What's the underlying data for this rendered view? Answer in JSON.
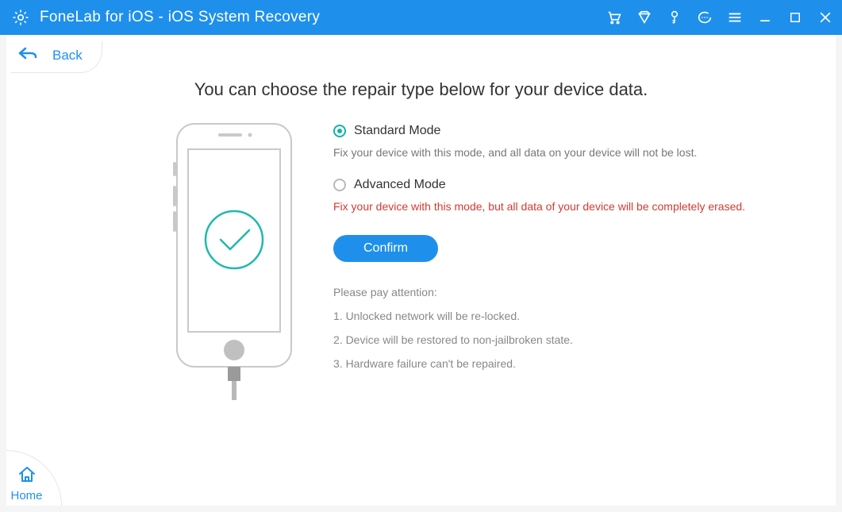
{
  "titlebar": {
    "title": "FoneLab for iOS - iOS System Recovery"
  },
  "back": {
    "label": "Back"
  },
  "main": {
    "heading": "You can choose the repair type below for your device data.",
    "option_standard": {
      "label": "Standard Mode",
      "desc": "Fix your device with this mode, and all data on your device will not be lost.",
      "selected": true
    },
    "option_advanced": {
      "label": "Advanced Mode",
      "desc": "Fix your device with this mode, but all data of your device will be completely erased.",
      "selected": false
    },
    "confirm_label": "Confirm",
    "attention_title": "Please pay attention:",
    "attention": [
      "1. Unlocked network will be re-locked.",
      "2. Device will be restored to non-jailbroken state.",
      "3. Hardware failure can't be repaired."
    ]
  },
  "home": {
    "label": "Home"
  }
}
